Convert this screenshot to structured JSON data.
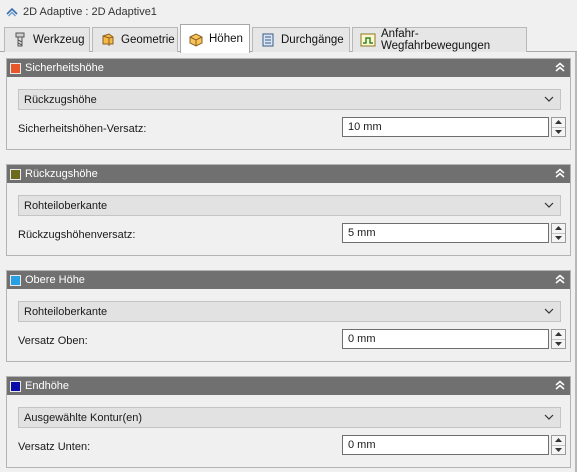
{
  "window": {
    "title": "2D Adaptive : 2D Adaptive1",
    "icon": "adaptive-operation-icon"
  },
  "tabs": [
    {
      "label": "Werkzeug",
      "icon": "tool-icon",
      "active": false
    },
    {
      "label": "Geometrie",
      "icon": "geometry-icon",
      "active": false
    },
    {
      "label": "Höhen",
      "icon": "heights-icon",
      "active": true
    },
    {
      "label": "Durchgänge",
      "icon": "passes-icon",
      "active": false
    },
    {
      "label": "Anfahr-Wegfahrbewegungen",
      "icon": "linking-icon",
      "active": false
    }
  ],
  "groups": [
    {
      "title": "Sicherheitshöhe",
      "color": "#e8572a",
      "dropdown": "Rückzugshöhe",
      "field_label": "Sicherheitshöhen-Versatz:",
      "field_value": "10 mm"
    },
    {
      "title": "Rückzugshöhe",
      "color": "#6b6a1e",
      "dropdown": "Rohteiloberkante",
      "field_label": "Rückzugshöhenversatz:",
      "field_value": "5 mm"
    },
    {
      "title": "Obere Höhe",
      "color": "#27a0e6",
      "dropdown": "Rohteiloberkante",
      "field_label": "Versatz Oben:",
      "field_value": "0 mm"
    },
    {
      "title": "Endhöhe",
      "color": "#0a0aa8",
      "dropdown": "Ausgewählte Kontur(en)",
      "field_label": "Versatz Unten:",
      "field_value": "0 mm"
    }
  ]
}
